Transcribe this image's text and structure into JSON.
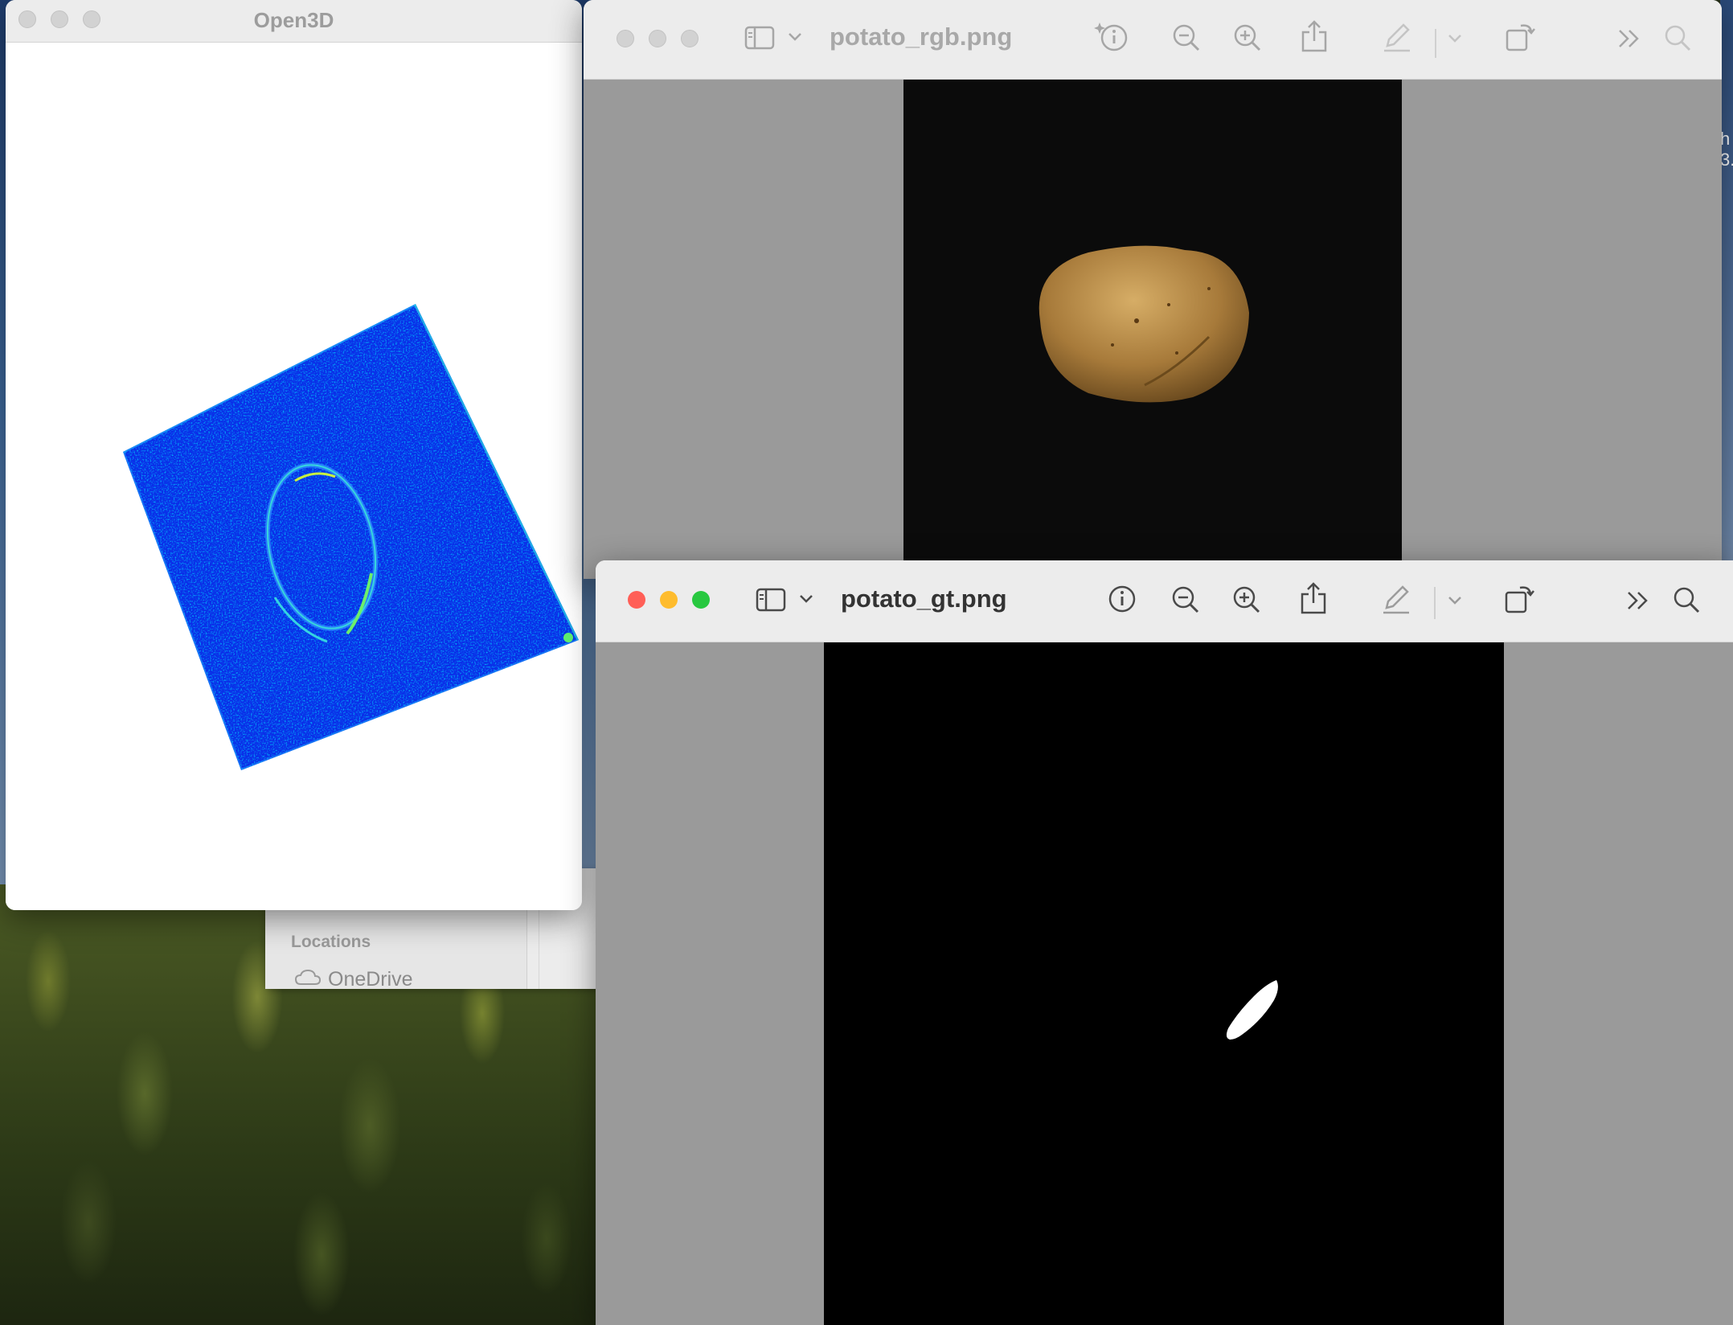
{
  "desktop": {
    "finder": {
      "section_label": "Locations",
      "onedrive_label": "OneDrive"
    },
    "edge_text": "h\n3."
  },
  "open3d_window": {
    "title": "Open3D",
    "point_cloud_colormap": "jet",
    "background_color": "#ffffff"
  },
  "rgb_window": {
    "title": "potato_rgb.png",
    "active": false,
    "toolbar": [
      "sidebar-toggle",
      "sidebar-dropdown",
      "info",
      "zoom-out",
      "zoom-in",
      "share",
      "markup",
      "markup-dropdown",
      "rotate",
      "more",
      "search"
    ]
  },
  "gt_window": {
    "title": "potato_gt.png",
    "active": true,
    "toolbar": [
      "sidebar-toggle",
      "sidebar-dropdown",
      "info",
      "zoom-out",
      "zoom-in",
      "share",
      "markup",
      "markup-dropdown",
      "rotate",
      "more",
      "search"
    ]
  },
  "colors": {
    "close": "#ff5f57",
    "minimize": "#febc2e",
    "zoom": "#28c840",
    "preview_bg": "#9a9a9a"
  }
}
